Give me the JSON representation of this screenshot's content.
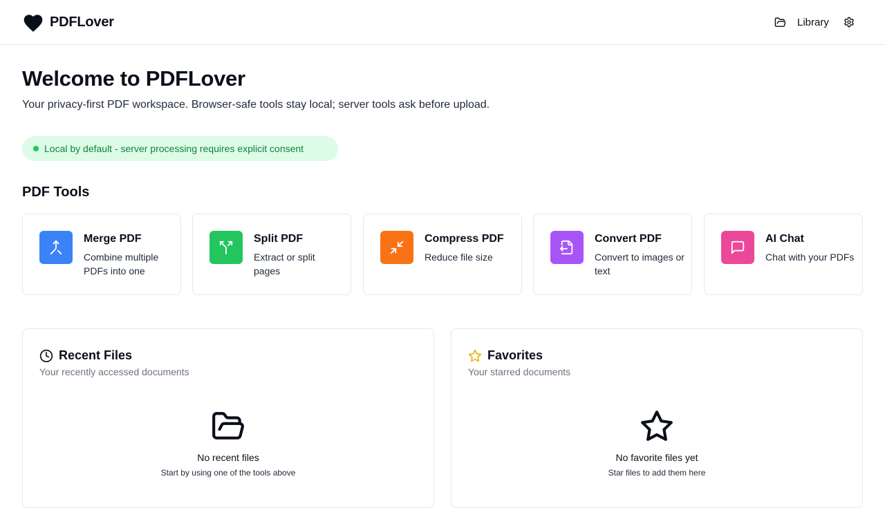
{
  "header": {
    "brand_name": "PDFLover",
    "library_label": "Library",
    "icons": {
      "logo": "heart-icon",
      "library": "folder-open-icon",
      "settings": "gear-icon"
    }
  },
  "hero": {
    "title": "Welcome to PDFLover",
    "subtitle": "Your privacy-first PDF workspace. Browser-safe tools stay local; server tools ask before upload.",
    "consent_badge": "Local by default - server processing requires explicit consent"
  },
  "tools_section": {
    "title": "PDF Tools",
    "items": [
      {
        "name": "Merge PDF",
        "description": "Combine multiple PDFs into one",
        "icon": "merge-icon",
        "color": "#3b82f6"
      },
      {
        "name": "Split PDF",
        "description": "Extract or split pages",
        "icon": "split-icon",
        "color": "#22c55e"
      },
      {
        "name": "Compress PDF",
        "description": "Reduce file size",
        "icon": "compress-icon",
        "color": "#f97316"
      },
      {
        "name": "Convert PDF",
        "description": "Convert to images or text",
        "icon": "file-convert-icon",
        "color": "#a855f7"
      },
      {
        "name": "AI Chat",
        "description": "Chat with your PDFs",
        "icon": "chat-icon",
        "color": "#ec4899"
      }
    ]
  },
  "recent_files": {
    "title": "Recent Files",
    "subtitle": "Your recently accessed documents",
    "empty_title": "No recent files",
    "empty_subtitle": "Start by using one of the tools above",
    "icon": "clock-icon",
    "empty_icon": "folder-open-icon"
  },
  "favorites": {
    "title": "Favorites",
    "subtitle": "Your starred documents",
    "empty_title": "No favorite files yet",
    "empty_subtitle": "Star files to add them here",
    "icon": "star-icon",
    "empty_icon": "star-icon"
  },
  "colors": {
    "consent_bg": "#dcfce7",
    "consent_text": "#15803d",
    "consent_dot": "#22c55e",
    "favorites_star": "#eab308"
  }
}
